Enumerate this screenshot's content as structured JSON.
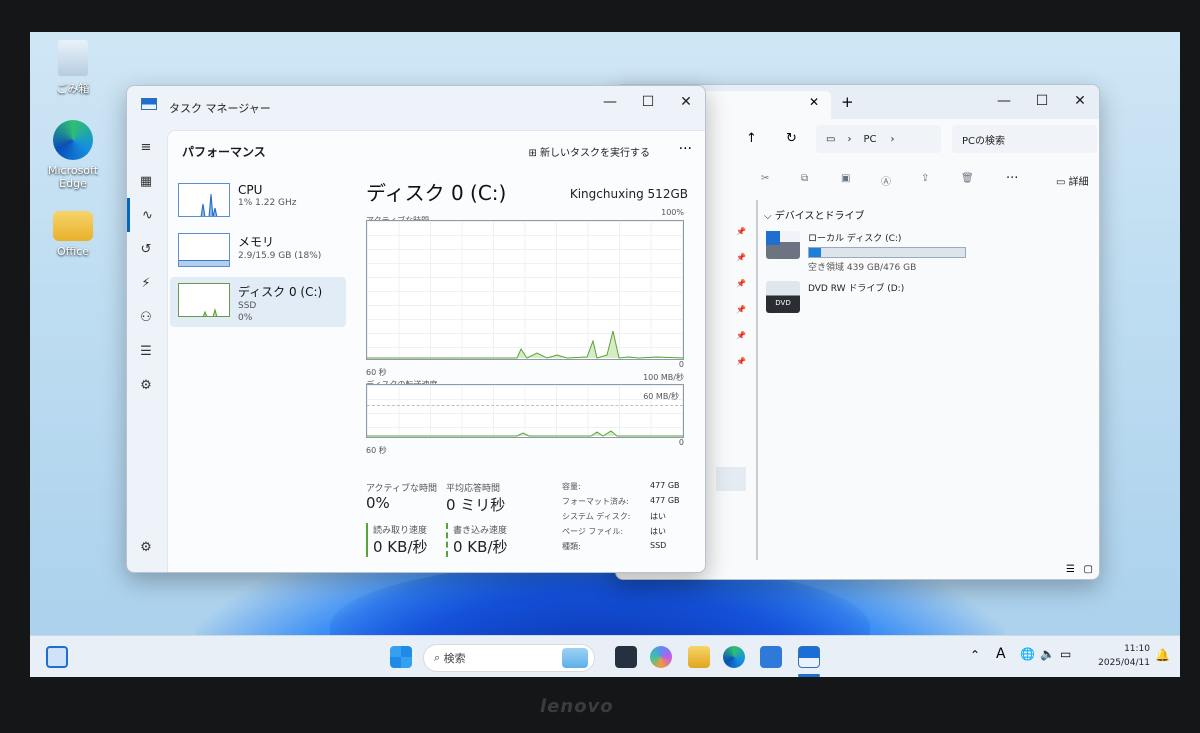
{
  "desktop": {
    "icons": [
      {
        "label": "ごみ箱"
      },
      {
        "label": "Microsoft Edge"
      },
      {
        "label": "Office"
      }
    ]
  },
  "task_manager": {
    "title": "タスク マネージャー",
    "section_title": "パフォーマンス",
    "run_task_label": "新しいタスクを実行する",
    "devices": [
      {
        "name": "CPU",
        "line1": "1%  1.22 GHz",
        "line2": ""
      },
      {
        "name": "メモリ",
        "line1": "2.9/15.9 GB (18%)",
        "line2": ""
      },
      {
        "name": "ディスク 0 (C:)",
        "line1": "SSD",
        "line2": "0%"
      }
    ],
    "detail": {
      "title": "ディスク 0 (C:)",
      "model": "Kingchuxing 512GB",
      "active_time_label": "アクティブな時間",
      "active_time_max": "100%",
      "time_left": "60 秒",
      "zero": "0",
      "transfer_label": "ディスクの転送速度",
      "transfer_max": "100 MB/秒",
      "transfer_mid": "60 MB/秒",
      "stats": {
        "active_label": "アクティブな時間",
        "active_value": "0%",
        "resp_label": "平均応答時間",
        "resp_value": "0 ミリ秒",
        "read_label": "読み取り速度",
        "read_value": "0 KB/秒",
        "write_label": "書き込み速度",
        "write_value": "0 KB/秒"
      },
      "props": [
        {
          "k": "容量:",
          "v": "477 GB"
        },
        {
          "k": "フォーマット済み:",
          "v": "477 GB"
        },
        {
          "k": "システム ディスク:",
          "v": "はい"
        },
        {
          "k": "ページ ファイル:",
          "v": "はい"
        },
        {
          "k": "種類:",
          "v": "SSD"
        }
      ]
    }
  },
  "explorer": {
    "addr_pc": "PC",
    "search_placeholder": "PCの検索",
    "details_label": "詳細",
    "section": "デバイスとドライブ",
    "drives": [
      {
        "name": "ローカル ディスク (C:)",
        "free": "空き領域 439 GB/476 GB",
        "used_fraction": 0.08
      },
      {
        "name": "DVD RW ドライブ (D:)",
        "free": ""
      }
    ]
  },
  "taskbar": {
    "search_label": "検索",
    "ime": "A",
    "time": "11:10",
    "date": "2025/04/11"
  },
  "brand": "lenovo"
}
